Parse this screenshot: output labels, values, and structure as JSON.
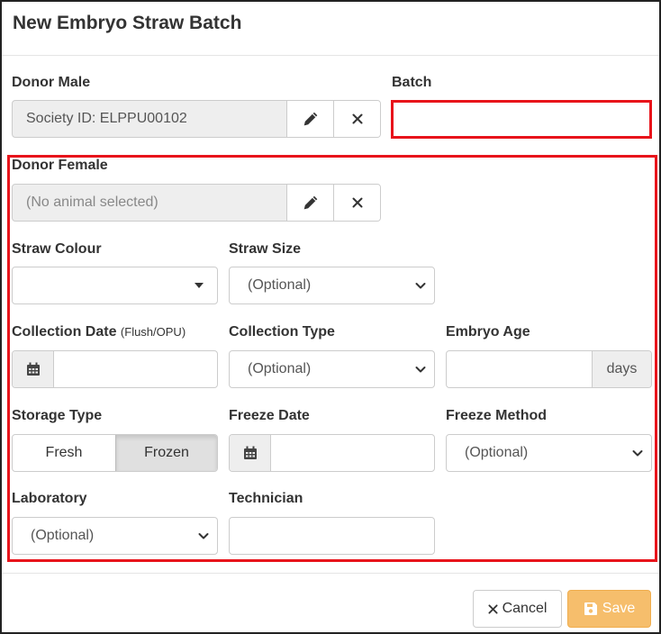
{
  "dialog": {
    "title": "New Embryo Straw Batch"
  },
  "donor_male": {
    "label": "Donor Male",
    "value": "Society ID: ELPPU00102"
  },
  "batch": {
    "label": "Batch",
    "value": ""
  },
  "donor_female": {
    "label": "Donor Female",
    "value": "(No animal selected)"
  },
  "straw_colour": {
    "label": "Straw Colour",
    "value": ""
  },
  "straw_size": {
    "label": "Straw Size",
    "value": "(Optional)"
  },
  "collection_date": {
    "label": "Collection Date",
    "hint": "(Flush/OPU)",
    "value": ""
  },
  "collection_type": {
    "label": "Collection Type",
    "value": "(Optional)"
  },
  "embryo_age": {
    "label": "Embryo Age",
    "value": "",
    "unit": "days"
  },
  "storage_type": {
    "label": "Storage Type",
    "options": [
      "Fresh",
      "Frozen"
    ],
    "selected": "Frozen"
  },
  "freeze_date": {
    "label": "Freeze Date",
    "value": ""
  },
  "freeze_method": {
    "label": "Freeze Method",
    "value": "(Optional)"
  },
  "laboratory": {
    "label": "Laboratory",
    "value": "(Optional)"
  },
  "technician": {
    "label": "Technician",
    "value": ""
  },
  "footer": {
    "cancel_label": "Cancel",
    "save_label": "Save"
  },
  "colors": {
    "highlight": "#e8141b",
    "save_button": "#f6be6c",
    "readonly_bg": "#eeeeee"
  },
  "icons": {
    "edit": "pencil-icon",
    "clear": "times-icon",
    "calendar": "calendar-icon",
    "save": "floppy-disk-icon",
    "dropdown": "chevron-down-icon"
  }
}
